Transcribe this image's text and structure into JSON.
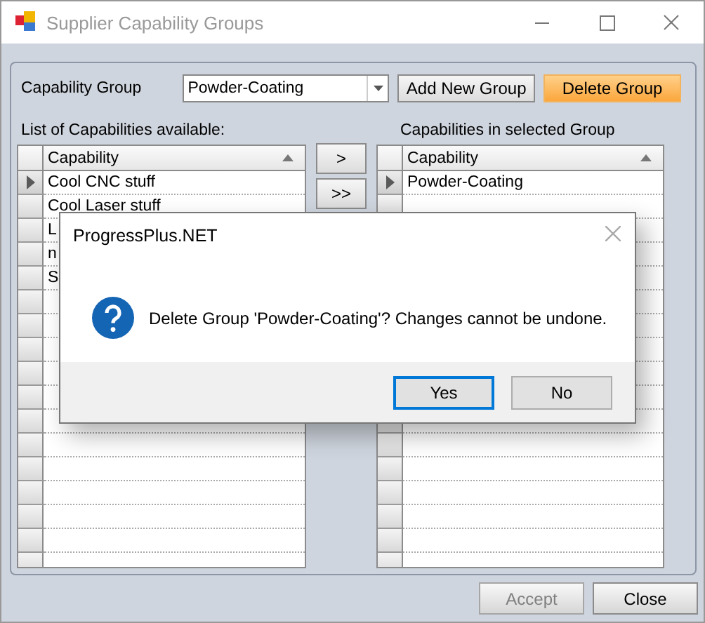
{
  "window": {
    "title": "Supplier Capability Groups"
  },
  "group_selector": {
    "label": "Capability Group",
    "value": "Powder-Coating"
  },
  "toolbar_buttons": [
    {
      "label": "Add New Group",
      "kind": "normal"
    },
    {
      "label": "Delete Group",
      "kind": "highlighted"
    }
  ],
  "available": {
    "heading": "List of Capabilities available:",
    "column": "Capability",
    "rows": [
      {
        "text": "Cool CNC stuff",
        "current": true
      },
      {
        "text": "Cool Laser stuff",
        "current": false
      },
      {
        "text": "L",
        "current": false
      },
      {
        "text": "n",
        "current": false
      },
      {
        "text": "S",
        "current": false
      }
    ]
  },
  "move_buttons": [
    ">",
    ">>"
  ],
  "selected_group": {
    "heading": "Capabilities in selected Group",
    "column": "Capability",
    "rows": [
      {
        "text": "Powder-Coating",
        "current": true
      }
    ]
  },
  "footer_buttons": [
    {
      "label": "Accept",
      "disabled": true
    },
    {
      "label": "Close",
      "disabled": false
    }
  ],
  "dialog": {
    "title": "ProgressPlus.NET",
    "message": "Delete Group 'Powder-Coating'? Changes cannot be undone.",
    "buttons": [
      {
        "label": "Yes",
        "default": true
      },
      {
        "label": "No",
        "default": false
      }
    ]
  }
}
